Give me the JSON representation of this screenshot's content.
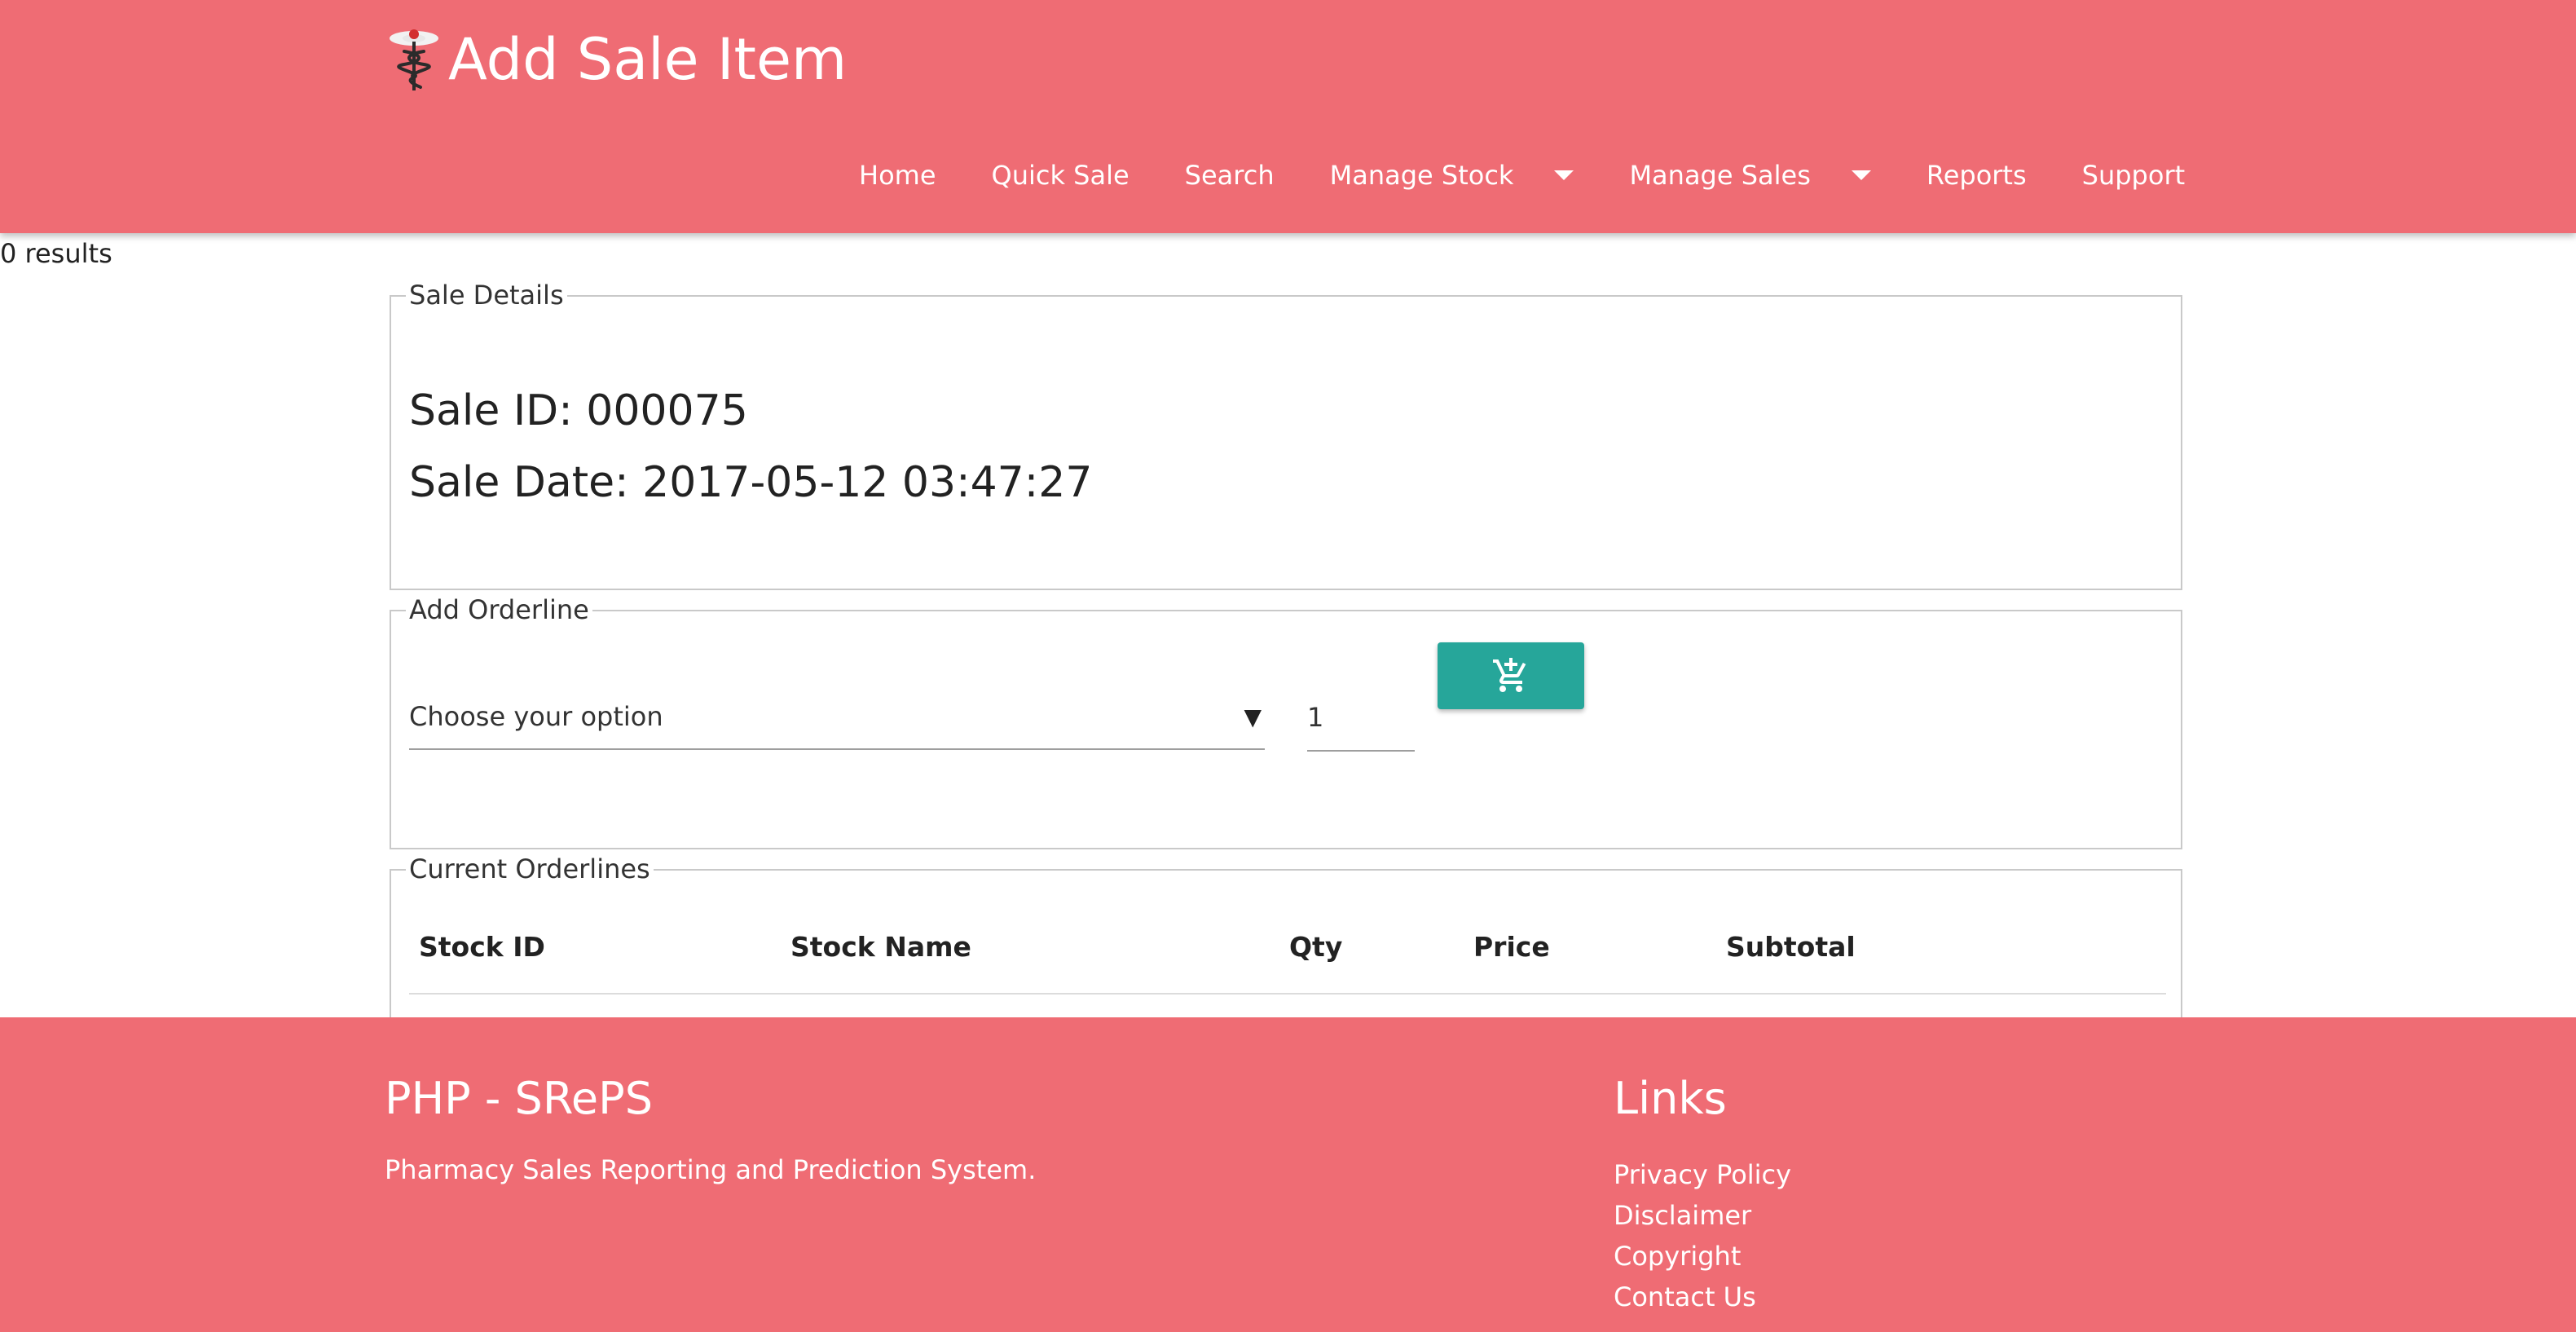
{
  "header": {
    "title": "Add Sale Item",
    "logo_icon": "caduceus-icon",
    "bg_color": "#ef6c74"
  },
  "nav": {
    "items": [
      {
        "label": "Home"
      },
      {
        "label": "Quick Sale"
      },
      {
        "label": "Search"
      },
      {
        "label": "Manage Stock",
        "dropdown": true
      },
      {
        "label": "Manage Sales",
        "dropdown": true
      },
      {
        "label": "Reports"
      },
      {
        "label": "Support"
      }
    ]
  },
  "results": {
    "text": "0 results"
  },
  "sale_details": {
    "legend": "Sale Details",
    "sale_id": "Sale ID: 000075",
    "sale_date": "Sale Date: 2017-05-12 03:47:27"
  },
  "add_orderline": {
    "legend": "Add Orderline",
    "select_value": "Choose your option",
    "quantity": "1",
    "add_button_icon": "add-shopping-cart-icon",
    "button_color": "#26a69a"
  },
  "current_orderlines": {
    "legend": "Current Orderlines",
    "columns": [
      "Stock ID",
      "Stock Name",
      "Qty",
      "Price",
      "Subtotal"
    ],
    "rows": []
  },
  "footer": {
    "title": "PHP - SRePS",
    "description": "Pharmacy Sales Reporting and Prediction System.",
    "links_title": "Links",
    "links": [
      "Privacy Policy",
      "Disclaimer",
      "Copyright",
      "Contact Us"
    ]
  }
}
